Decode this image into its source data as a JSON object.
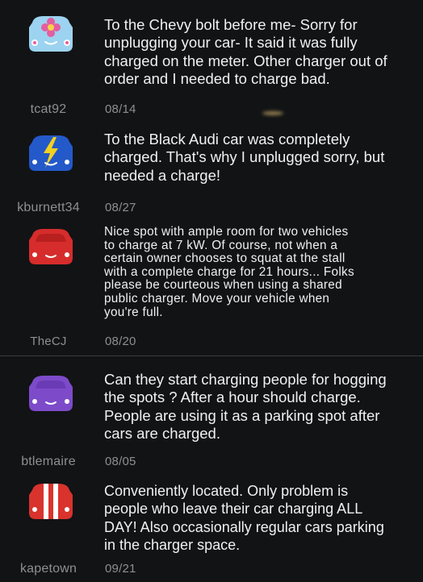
{
  "reviews": [
    {
      "username": "tcat92",
      "date": "08/14",
      "text": "To the Chevy bolt before me- Sorry for\nunplugging your car- It said it was fully\ncharged on the meter. Other charger out of\norder and I needed to charge bad.",
      "avatar_icon": "flower-car-icon",
      "avatar_color": "#9cd3f0"
    },
    {
      "username": "kburnett34",
      "date": "08/27",
      "text": "To the Black Audi car was completely\ncharged. That's why I unplugged sorry, but\nneeded a charge!",
      "avatar_icon": "lightning-car-icon",
      "avatar_color": "#2459c9"
    },
    {
      "username": "TheCJ",
      "date": "08/20",
      "text": "Nice spot with ample room for two vehicles\nto charge at 7 kW. Of course, not when a\ncertain owner chooses to squat at the stall\nwith a complete charge for 21 hours... Folks\nplease be courteous when using a shared\npublic charger. Move your vehicle when\nyou're full.",
      "avatar_icon": "car-icon",
      "avatar_color": "#d62c2c"
    },
    {
      "username": "btlemaire",
      "date": "08/05",
      "text": "Can they start charging people for hogging\nthe spots ? After a hour should charge.\nPeople are using it as a parking spot after\ncars are charged.",
      "avatar_icon": "car-icon",
      "avatar_color": "#7d4bc9"
    },
    {
      "username": "kapetown",
      "date": "09/21",
      "text": "Conveniently located. Only problem is\npeople who leave their car charging ALL\nDAY! Also occasionally regular cars  parking\nin the charger space.",
      "avatar_icon": "racing-stripe-car-icon",
      "avatar_color": "#d8332c"
    }
  ],
  "colors": {
    "background": "#121315",
    "text": "#f0f0f2",
    "meta": "#8e8f93",
    "divider": "#3b3c41"
  }
}
